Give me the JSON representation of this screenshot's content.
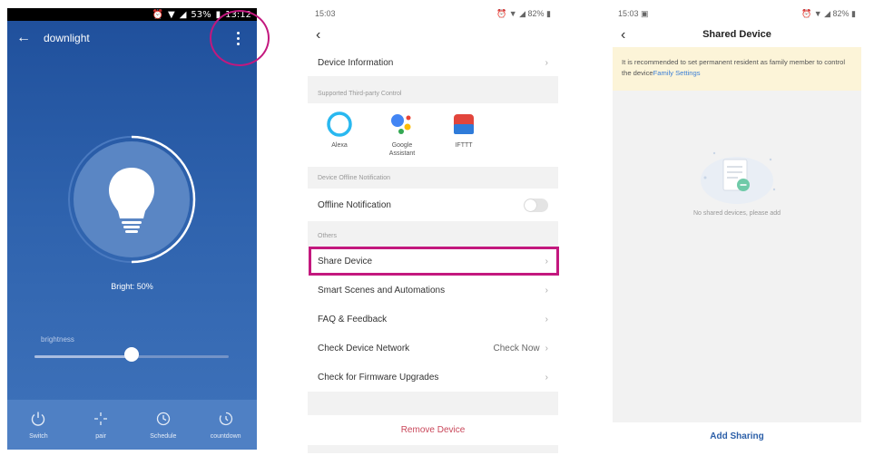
{
  "screen1": {
    "status": {
      "battery": "53%",
      "time": "13:12"
    },
    "header": {
      "title": "downlight"
    },
    "bright_text": "Bright: 50%",
    "brightness_label": "brightness",
    "brightness_value": 0.5,
    "tabs": [
      {
        "label": "Switch",
        "icon": "power-icon"
      },
      {
        "label": "pair",
        "icon": "sparkle-icon"
      },
      {
        "label": "Schedule",
        "icon": "clock-icon"
      },
      {
        "label": "countdown",
        "icon": "timer-icon"
      }
    ],
    "colors": {
      "bg_top": "#1f4f9b",
      "bg_bottom": "#3f73bb",
      "bulb": "#ffffff"
    }
  },
  "screen2": {
    "status": {
      "time": "15:03",
      "battery": "82%"
    },
    "device_info": "Device Information",
    "third_party_header": "Supported Third-party Control",
    "third_party": [
      {
        "label": "Alexa"
      },
      {
        "label": "Google Assistant"
      },
      {
        "label": "IFTTT"
      }
    ],
    "offline_header": "Device Offline Notification",
    "offline_label": "Offline Notification",
    "offline_enabled": false,
    "others_header": "Others",
    "menu": [
      {
        "label": "Share Device",
        "value": ""
      },
      {
        "label": "Smart Scenes and Automations",
        "value": ""
      },
      {
        "label": "FAQ & Feedback",
        "value": ""
      },
      {
        "label": "Check Device Network",
        "value": "Check Now"
      },
      {
        "label": "Check for Firmware Upgrades",
        "value": ""
      }
    ],
    "remove_label": "Remove Device",
    "colors": {
      "highlight": "#c3187e",
      "remove": "#c9475a"
    }
  },
  "screen3": {
    "status": {
      "time": "15:03",
      "battery": "82%"
    },
    "title": "Shared Device",
    "notice_text": "It is recommended to set permanent resident as family member to control the device",
    "notice_link": "Family Settings",
    "empty_text": "No shared devices, please add",
    "add_label": "Add Sharing",
    "colors": {
      "notice_bg": "#fcf4d8",
      "link": "#3c7fd6",
      "add": "#2c5fa8"
    }
  }
}
